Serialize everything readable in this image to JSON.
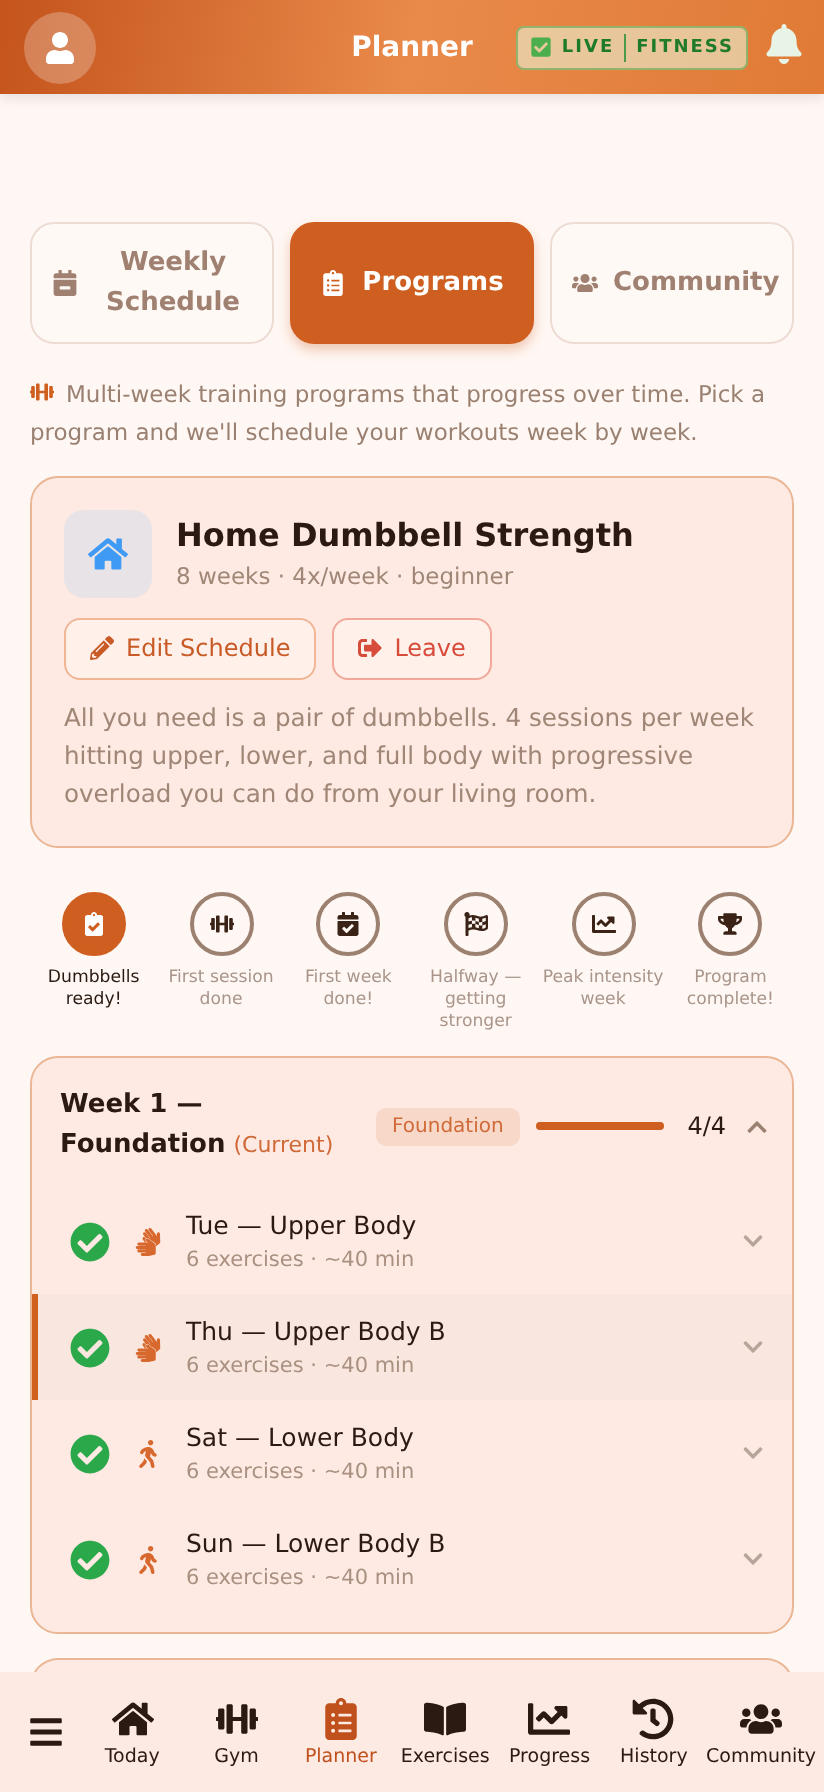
{
  "header": {
    "title": "Planner",
    "badge": {
      "checked": true,
      "live": "LIVE",
      "brand": "FITNESS"
    }
  },
  "tabs": [
    {
      "label": "Weekly Schedule",
      "kind": "calendar",
      "selected": false
    },
    {
      "label": "Programs",
      "kind": "clipboard",
      "selected": true
    },
    {
      "label": "Community",
      "kind": "users",
      "selected": false
    }
  ],
  "intro": "Multi-week training programs that progress over time. Pick a program and we'll schedule your workouts week by week.",
  "program": {
    "title": "Home Dumbbell Strength",
    "meta": "8 weeks · 4x/week · beginner",
    "actions": [
      {
        "label": "Edit Schedule",
        "kind": "edit"
      },
      {
        "label": "Leave",
        "kind": "leave"
      }
    ],
    "description": "All you need is a pair of dumbbells. 4 sessions per week hitting upper, lower, and full body with progressive overload you can do from your living room."
  },
  "milestones": [
    {
      "label": "Dumbbells ready!",
      "kind": "clipboard",
      "achieved": true
    },
    {
      "label": "First session done",
      "kind": "dumbbell",
      "achieved": false
    },
    {
      "label": "First week done!",
      "kind": "calendar",
      "achieved": false
    },
    {
      "label": "Halfway — getting stronger",
      "kind": "flag",
      "achieved": false
    },
    {
      "label": "Peak intensity week",
      "kind": "chart",
      "achieved": false
    },
    {
      "label": "Program complete!",
      "kind": "trophy",
      "achieved": false
    }
  ],
  "week": {
    "title": "Week 1 — Foundation",
    "current": "(Current)",
    "phase": "Foundation",
    "level": 1,
    "count": "4/4",
    "expanded": true,
    "sessions": [
      {
        "name": "Tue — Upper Body",
        "meta": "6 exercises · ~40 min",
        "kind": "upper",
        "done": true,
        "selected": false
      },
      {
        "name": "Thu — Upper Body B",
        "meta": "6 exercises · ~40 min",
        "kind": "upper",
        "done": true,
        "selected": true
      },
      {
        "name": "Sat — Lower Body",
        "meta": "6 exercises · ~40 min",
        "kind": "lower",
        "done": true,
        "selected": false
      },
      {
        "name": "Sun — Lower Body B",
        "meta": "6 exercises · ~40 min",
        "kind": "lower",
        "done": true,
        "selected": false
      }
    ]
  },
  "nav": [
    {
      "label": "Today",
      "kind": "home",
      "selected": false
    },
    {
      "label": "Gym",
      "kind": "dumbbell",
      "selected": false
    },
    {
      "label": "Planner",
      "kind": "clipboard",
      "selected": true
    },
    {
      "label": "Exercises",
      "kind": "book",
      "selected": false
    },
    {
      "label": "Progress",
      "kind": "chart",
      "selected": false
    },
    {
      "label": "History",
      "kind": "history",
      "selected": false
    },
    {
      "label": "Community",
      "kind": "users",
      "selected": false
    }
  ]
}
